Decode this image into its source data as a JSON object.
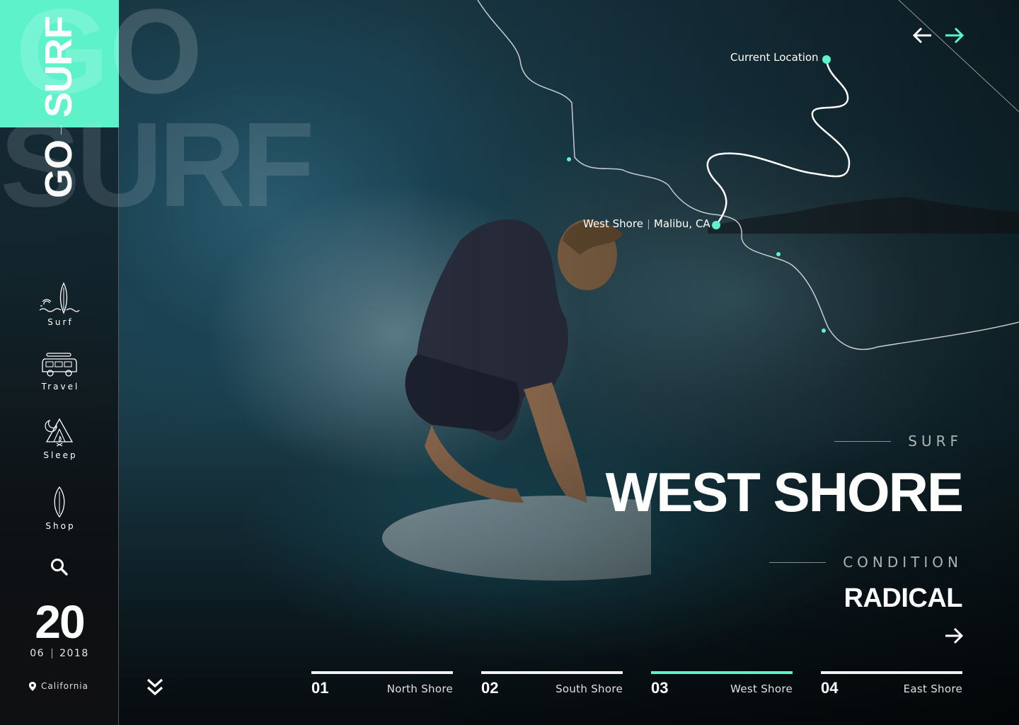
{
  "brand": {
    "go": "GO",
    "surf": "SURF",
    "ghost_go": "GO",
    "ghost_surf": "SURF",
    "accent": "#5ef2cb"
  },
  "sidebar": {
    "items": [
      {
        "label": "Surf",
        "icon": "surfboard-beach-icon"
      },
      {
        "label": "Travel",
        "icon": "camper-van-icon"
      },
      {
        "label": "Sleep",
        "icon": "tent-icon"
      },
      {
        "label": "Shop",
        "icon": "surfboard-icon"
      }
    ],
    "search_icon": "search-icon",
    "day": "20",
    "month": "06",
    "year": "2018",
    "location": "California"
  },
  "map": {
    "current_location": "Current Location",
    "spot_name": "West Shore",
    "spot_place": "Malibu, CA"
  },
  "hero": {
    "kicker": "SURF",
    "title": "WEST SHORE",
    "condition_label": "CONDITION",
    "condition_value": "RADICAL"
  },
  "tabs": [
    {
      "num": "01",
      "name": "North Shore",
      "active": false
    },
    {
      "num": "02",
      "name": "South Shore",
      "active": false
    },
    {
      "num": "03",
      "name": "West Shore",
      "active": true
    },
    {
      "num": "04",
      "name": "East Shore",
      "active": false
    }
  ]
}
